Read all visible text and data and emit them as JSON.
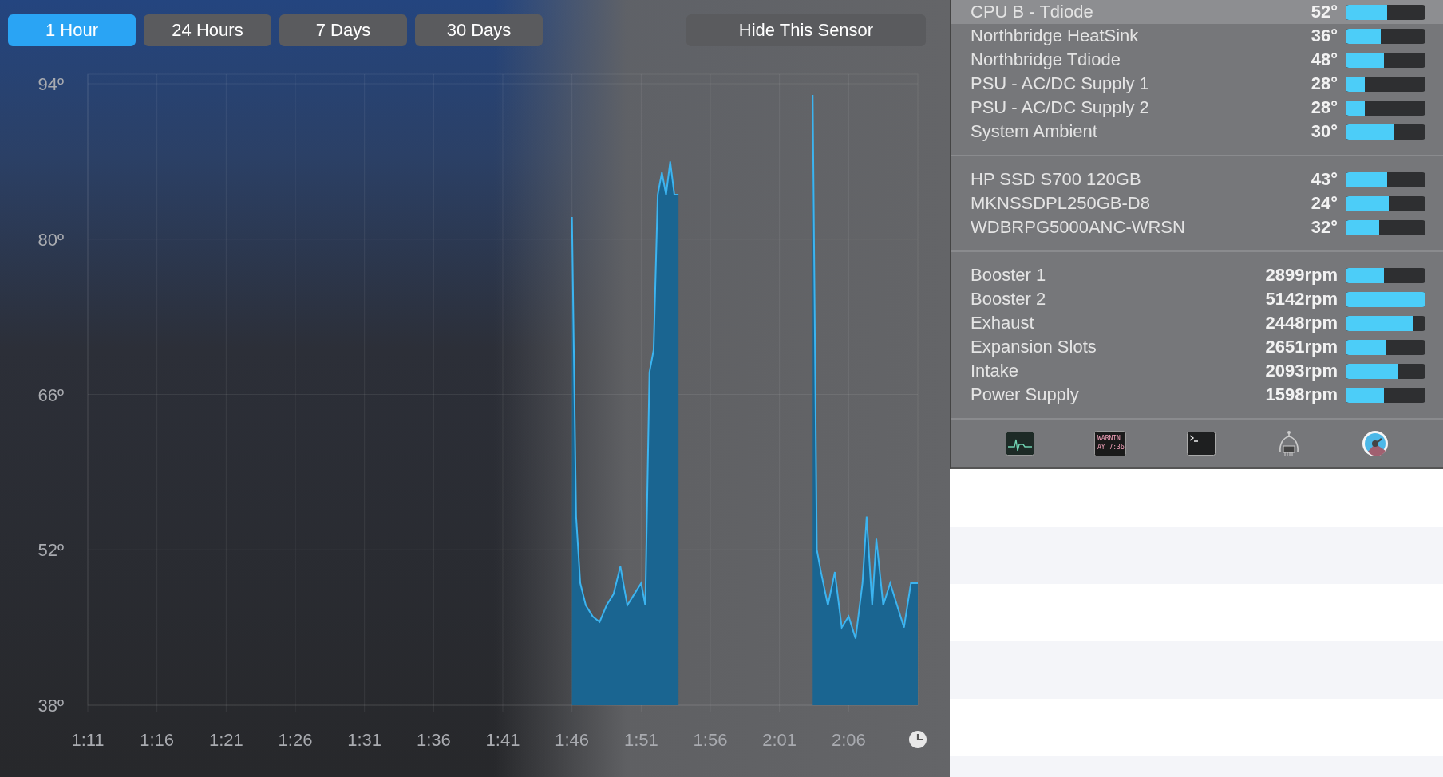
{
  "range_buttons": [
    {
      "label": "1 Hour",
      "selected": true
    },
    {
      "label": "24 Hours",
      "selected": false
    },
    {
      "label": "7 Days",
      "selected": false
    },
    {
      "label": "30 Days",
      "selected": false
    }
  ],
  "hide_button": {
    "label": "Hide This Sensor"
  },
  "chart": {
    "chart_data": {
      "type": "area",
      "grid": true,
      "xlim": [
        71,
        131
      ],
      "ylim": [
        38,
        94
      ],
      "yticks": [
        {
          "value": 94,
          "label": "94º"
        },
        {
          "value": 80,
          "label": "80º"
        },
        {
          "value": 66,
          "label": "66º"
        },
        {
          "value": 52,
          "label": "52º"
        },
        {
          "value": 38,
          "label": "38º"
        }
      ],
      "xticks": [
        {
          "value": 71,
          "label": "1:11"
        },
        {
          "value": 76,
          "label": "1:16"
        },
        {
          "value": 81,
          "label": "1:21"
        },
        {
          "value": 86,
          "label": "1:26"
        },
        {
          "value": 91,
          "label": "1:31"
        },
        {
          "value": 96,
          "label": "1:36"
        },
        {
          "value": 101,
          "label": "1:41"
        },
        {
          "value": 106,
          "label": "1:46"
        },
        {
          "value": 111,
          "label": "1:51"
        },
        {
          "value": 116,
          "label": "1:56"
        },
        {
          "value": 121,
          "label": "2:01"
        },
        {
          "value": 126,
          "label": "2:06"
        }
      ],
      "x": [
        106,
        106.3,
        106.6,
        107,
        107.5,
        108,
        108.5,
        109,
        109.5,
        110,
        110.5,
        111,
        111.3,
        111.6,
        111.9,
        112.2,
        112.5,
        112.8,
        113.1,
        113.4,
        113.7,
        114,
        123.3,
        123.4,
        123.7,
        124,
        124.5,
        125,
        125.5,
        126,
        126.5,
        127,
        127.3,
        127.7,
        128,
        128.5,
        129,
        129.5,
        130,
        130.5,
        131
      ],
      "series": [
        {
          "color": "#3cb4f0",
          "values": [
            82,
            55,
            49,
            47,
            46,
            45.5,
            47,
            48,
            50.5,
            47,
            48,
            49,
            47,
            68,
            70,
            84,
            86,
            84,
            87,
            84,
            84,
            null,
            null,
            93,
            52,
            50,
            47,
            50,
            45,
            46,
            44,
            49,
            55,
            47,
            53,
            47,
            49,
            47,
            45,
            49,
            49
          ]
        }
      ]
    }
  },
  "sensor_groups": [
    {
      "sensors": [
        {
          "name": "CPU B - Tdiode",
          "reading": "52°",
          "level": 0.52,
          "selected": true
        },
        {
          "name": "Northbridge HeatSink",
          "reading": "36°",
          "level": 0.44,
          "selected": false
        },
        {
          "name": "Northbridge Tdiode",
          "reading": "48°",
          "level": 0.48,
          "selected": false
        },
        {
          "name": "PSU - AC/DC Supply 1",
          "reading": "28°",
          "level": 0.24,
          "selected": false
        },
        {
          "name": "PSU - AC/DC Supply 2",
          "reading": "28°",
          "level": 0.24,
          "selected": false
        },
        {
          "name": "System Ambient",
          "reading": "30°",
          "level": 0.6,
          "selected": false
        }
      ]
    },
    {
      "sensors": [
        {
          "name": "HP SSD S700 120GB",
          "reading": "43°",
          "level": 0.52,
          "selected": false
        },
        {
          "name": "MKNSSDPL250GB-D8",
          "reading": "24°",
          "level": 0.54,
          "selected": false
        },
        {
          "name": "WDBRPG5000ANC-WRSN",
          "reading": "32°",
          "level": 0.42,
          "selected": false
        }
      ]
    },
    {
      "sensors": [
        {
          "name": "Booster 1",
          "reading": "2899rpm",
          "level": 0.48,
          "selected": false
        },
        {
          "name": "Booster 2",
          "reading": "5142rpm",
          "level": 0.99,
          "selected": false
        },
        {
          "name": "Exhaust",
          "reading": "2448rpm",
          "level": 0.84,
          "selected": false
        },
        {
          "name": "Expansion Slots",
          "reading": "2651rpm",
          "level": 0.5,
          "selected": false
        },
        {
          "name": "Intake",
          "reading": "2093rpm",
          "level": 0.66,
          "selected": false
        },
        {
          "name": "Power Supply",
          "reading": "1598rpm",
          "level": 0.48,
          "selected": false
        }
      ]
    }
  ],
  "toolbar": [
    {
      "kind": "activity"
    },
    {
      "kind": "console",
      "lines": [
        "WARNIN",
        "AY 7:36"
      ]
    },
    {
      "kind": "terminal"
    },
    {
      "kind": "chip"
    },
    {
      "kind": "gauge"
    }
  ]
}
